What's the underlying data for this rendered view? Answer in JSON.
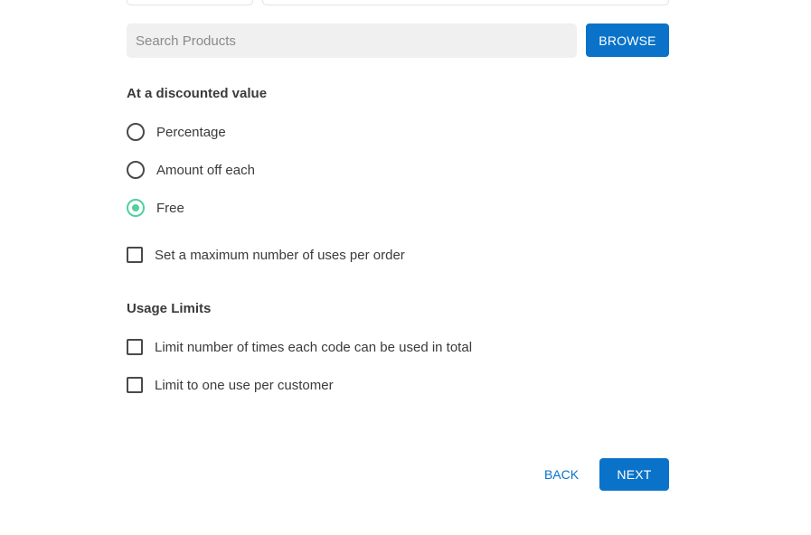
{
  "search": {
    "placeholder": "Search Products",
    "value": ""
  },
  "browse_button": "BROWSE",
  "discount": {
    "title": "At a discounted value",
    "options": [
      {
        "label": "Percentage",
        "selected": false
      },
      {
        "label": "Amount off each",
        "selected": false
      },
      {
        "label": "Free",
        "selected": true
      }
    ],
    "max_uses_label": "Set a maximum number of uses per order",
    "max_uses_checked": false
  },
  "usage_limits": {
    "title": "Usage Limits",
    "options": [
      {
        "label": "Limit number of times each code can be used in total",
        "checked": false
      },
      {
        "label": "Limit to one use per customer",
        "checked": false
      }
    ]
  },
  "footer": {
    "back_label": "BACK",
    "next_label": "NEXT"
  },
  "colors": {
    "primary": "#0a73c9",
    "radio_selected": "#4fd1a0",
    "input_bg": "#f0f0f0",
    "text": "#3b3b3b"
  }
}
